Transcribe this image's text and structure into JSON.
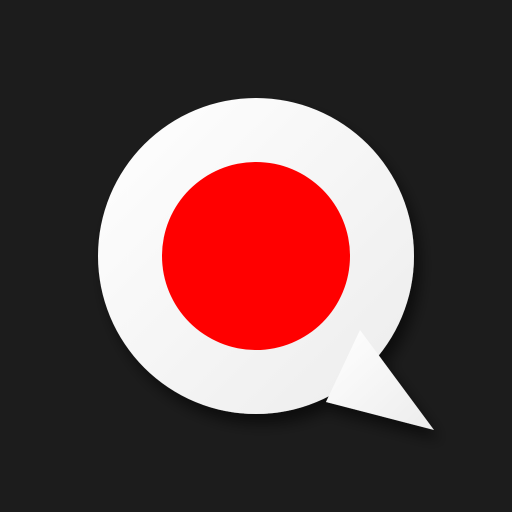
{
  "icon": {
    "name": "chat-bubble-record-icon",
    "background_color": "#1c1c1c",
    "bubble_color": "#f7f7f7",
    "dot_color": "#ff0000"
  }
}
